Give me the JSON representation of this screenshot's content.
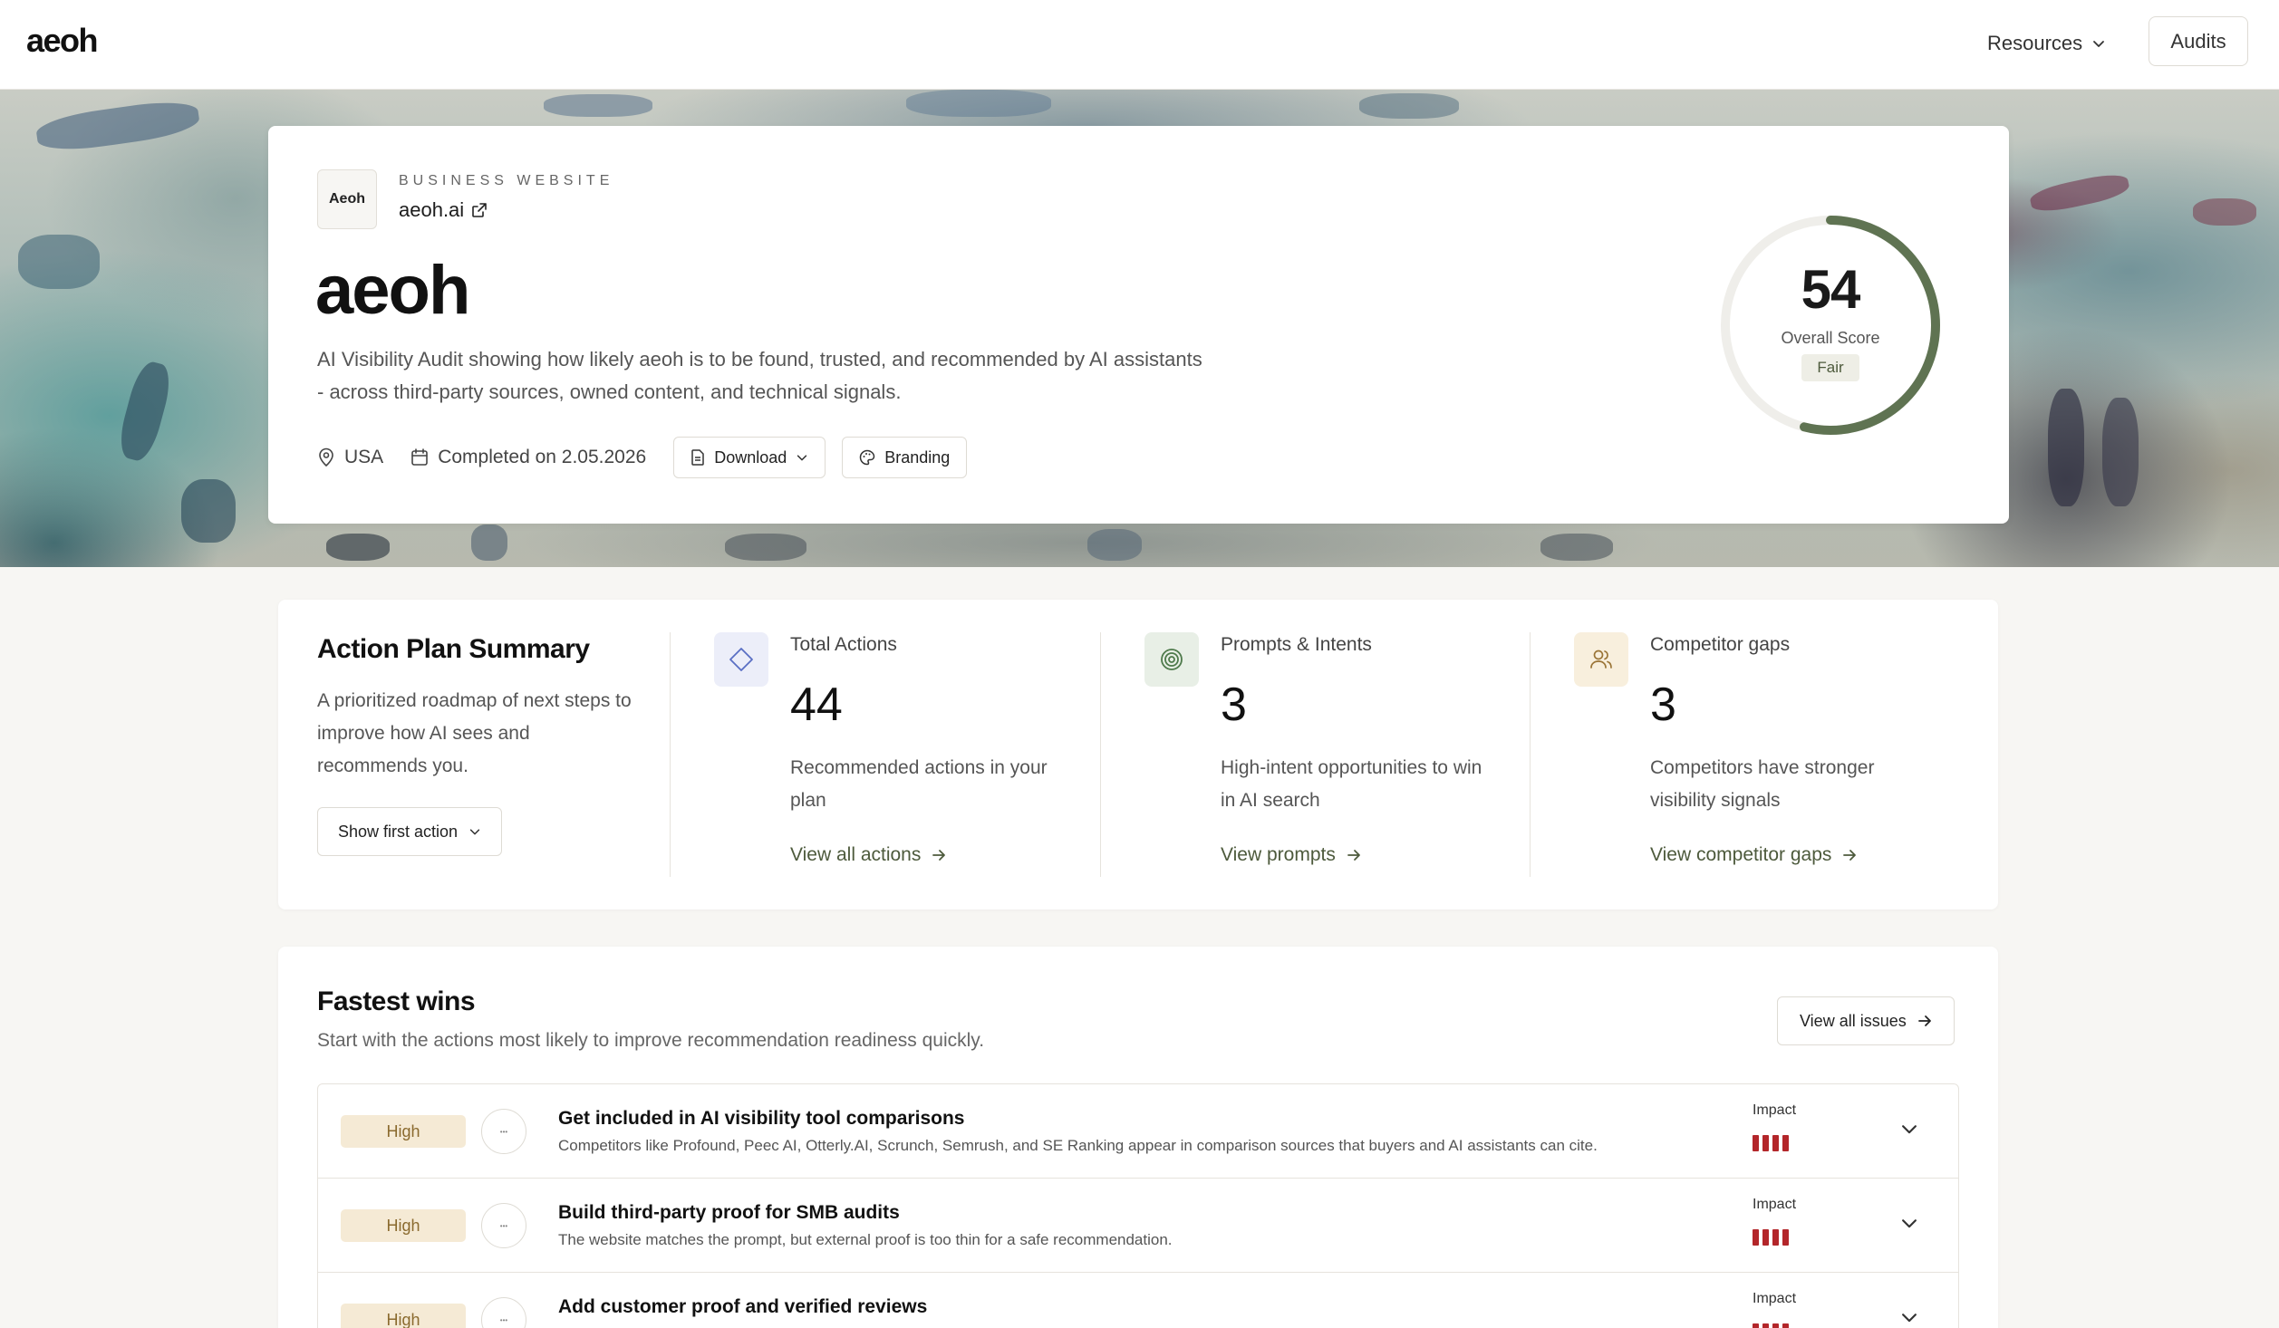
{
  "nav": {
    "logo": "aeoh",
    "resources_label": "Resources",
    "audits_label": "Audits"
  },
  "hero": {
    "brand_box_text": "Aeoh",
    "category_label": "BUSINESS WEBSITE",
    "site_link": "aeoh.ai",
    "title": "aeoh",
    "description": "AI Visibility Audit showing how likely aeoh is to be found, trusted, and recommended by AI assistants - across third-party sources, owned content, and technical signals.",
    "location": "USA",
    "completed": "Completed on 2.05.2026",
    "download_label": "Download",
    "branding_label": "Branding",
    "score": {
      "value": "54",
      "label": "Overall Score",
      "rating": "Fair",
      "fraction": 0.54,
      "color": "#5f7352"
    }
  },
  "summary": {
    "title": "Action Plan Summary",
    "description": "A prioritized roadmap of next steps to improve how AI sees and recommends you.",
    "button_label": "Show first action",
    "stats": [
      {
        "icon": "diamond-icon",
        "label": "Total Actions",
        "value": "44",
        "description": "Recommended actions in your plan",
        "link": "View all actions"
      },
      {
        "icon": "target-icon",
        "label": "Prompts & Intents",
        "value": "3",
        "description": "High-intent opportunities to win in AI search",
        "link": "View prompts"
      },
      {
        "icon": "users-icon",
        "label": "Competitor gaps",
        "value": "3",
        "description": "Competitors have stronger visibility signals",
        "link": "View competitor gaps"
      }
    ]
  },
  "wins": {
    "title": "Fastest wins",
    "subtitle": "Start with the actions most likely to improve recommendation readiness quickly.",
    "button_label": "View all issues",
    "impact_label": "Impact",
    "issues": [
      {
        "priority": "High",
        "title": "Get included in AI visibility tool comparisons",
        "description": "Competitors like Profound, Peec AI, Otterly.AI, Scrunch, Semrush, and SE Ranking appear in comparison sources that buyers and AI assistants can cite."
      },
      {
        "priority": "High",
        "title": "Build third-party proof for SMB audits",
        "description": "The website matches the prompt, but external proof is too thin for a safe recommendation."
      },
      {
        "priority": "High",
        "title": "Add customer proof and verified reviews",
        "description": ""
      }
    ]
  }
}
